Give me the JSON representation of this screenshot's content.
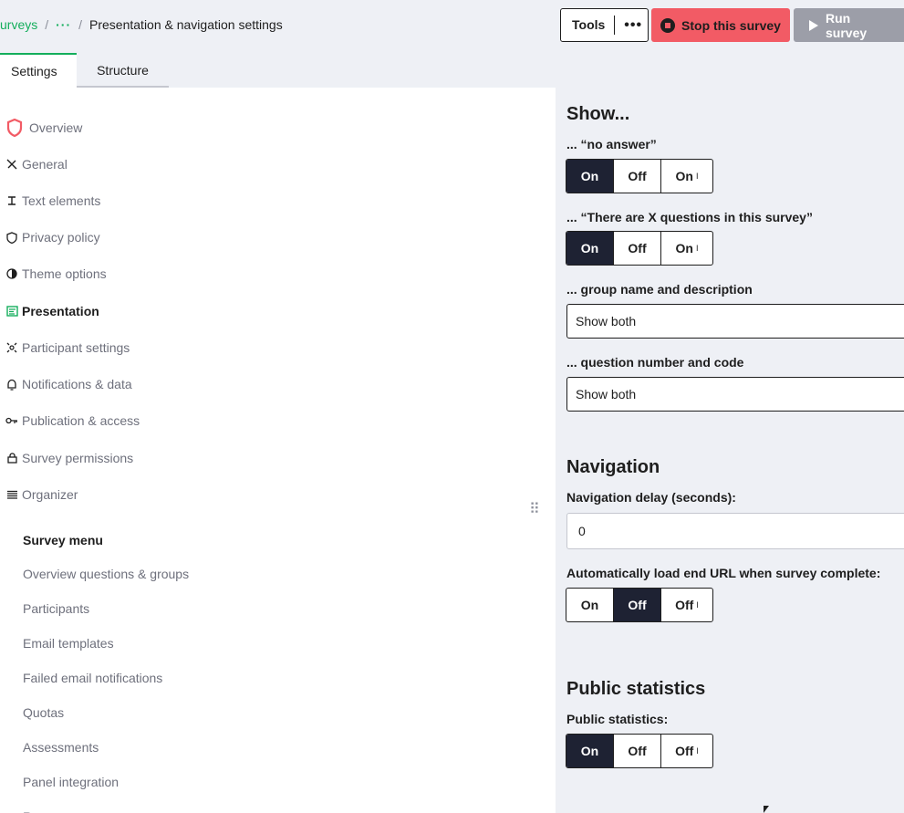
{
  "breadcrumb": {
    "link": "urveys",
    "sep1": "/",
    "dots": "···",
    "sep2": "/",
    "current": "Presentation & navigation settings"
  },
  "toolbar": {
    "tools_label": "Tools",
    "tools_more": "•••",
    "stop_label": "Stop this survey",
    "run_label": "Run survey"
  },
  "tabs": [
    {
      "label": "Settings"
    },
    {
      "label": "Structure"
    }
  ],
  "sidebar": {
    "items": [
      {
        "label": "Overview",
        "icon": "shield-icon"
      },
      {
        "label": "General",
        "icon": "tools-icon"
      },
      {
        "label": "Text elements",
        "icon": "text-icon"
      },
      {
        "label": "Privacy policy",
        "icon": "shield-small-icon"
      },
      {
        "label": "Theme options",
        "icon": "contrast-icon"
      },
      {
        "label": "Presentation",
        "icon": "presentation-icon"
      },
      {
        "label": "Participant settings",
        "icon": "participants-icon"
      },
      {
        "label": "Notifications & data",
        "icon": "bell-icon"
      },
      {
        "label": "Publication & access",
        "icon": "key-icon"
      },
      {
        "label": "Survey permissions",
        "icon": "lock-icon"
      },
      {
        "label": "Organizer",
        "icon": "list-icon"
      }
    ],
    "drag": "⠿",
    "menu_title": "Survey menu",
    "menu_links": [
      "Overview questions & groups",
      "Participants",
      "Email templates",
      "Failed email notifications",
      "Quotas",
      "Assessments",
      "Panel integration",
      "R"
    ]
  },
  "main": {
    "show_title": "Show...",
    "no_answer_label": "... “no answer”",
    "x_questions_label": "... “There are X questions in this survey”",
    "group_name_label": "... group name and description",
    "group_name_value": "Show both",
    "question_number_label": "... question number and code",
    "question_number_value": "Show both",
    "navigation_title": "Navigation",
    "nav_delay_label": "Navigation delay (seconds):",
    "nav_delay_value": "0",
    "autoload_label": "Automatically load end URL when survey complete:",
    "public_stats_title": "Public statistics",
    "public_stats_label": "Public statistics:",
    "seg_on": "On",
    "seg_off": "Off",
    "seg_inherit_mark": "I"
  },
  "colors": {
    "accent": "#14ae5c",
    "danger": "#f25b65",
    "disabled": "#9c9ea8",
    "selected": "#1e2233"
  }
}
